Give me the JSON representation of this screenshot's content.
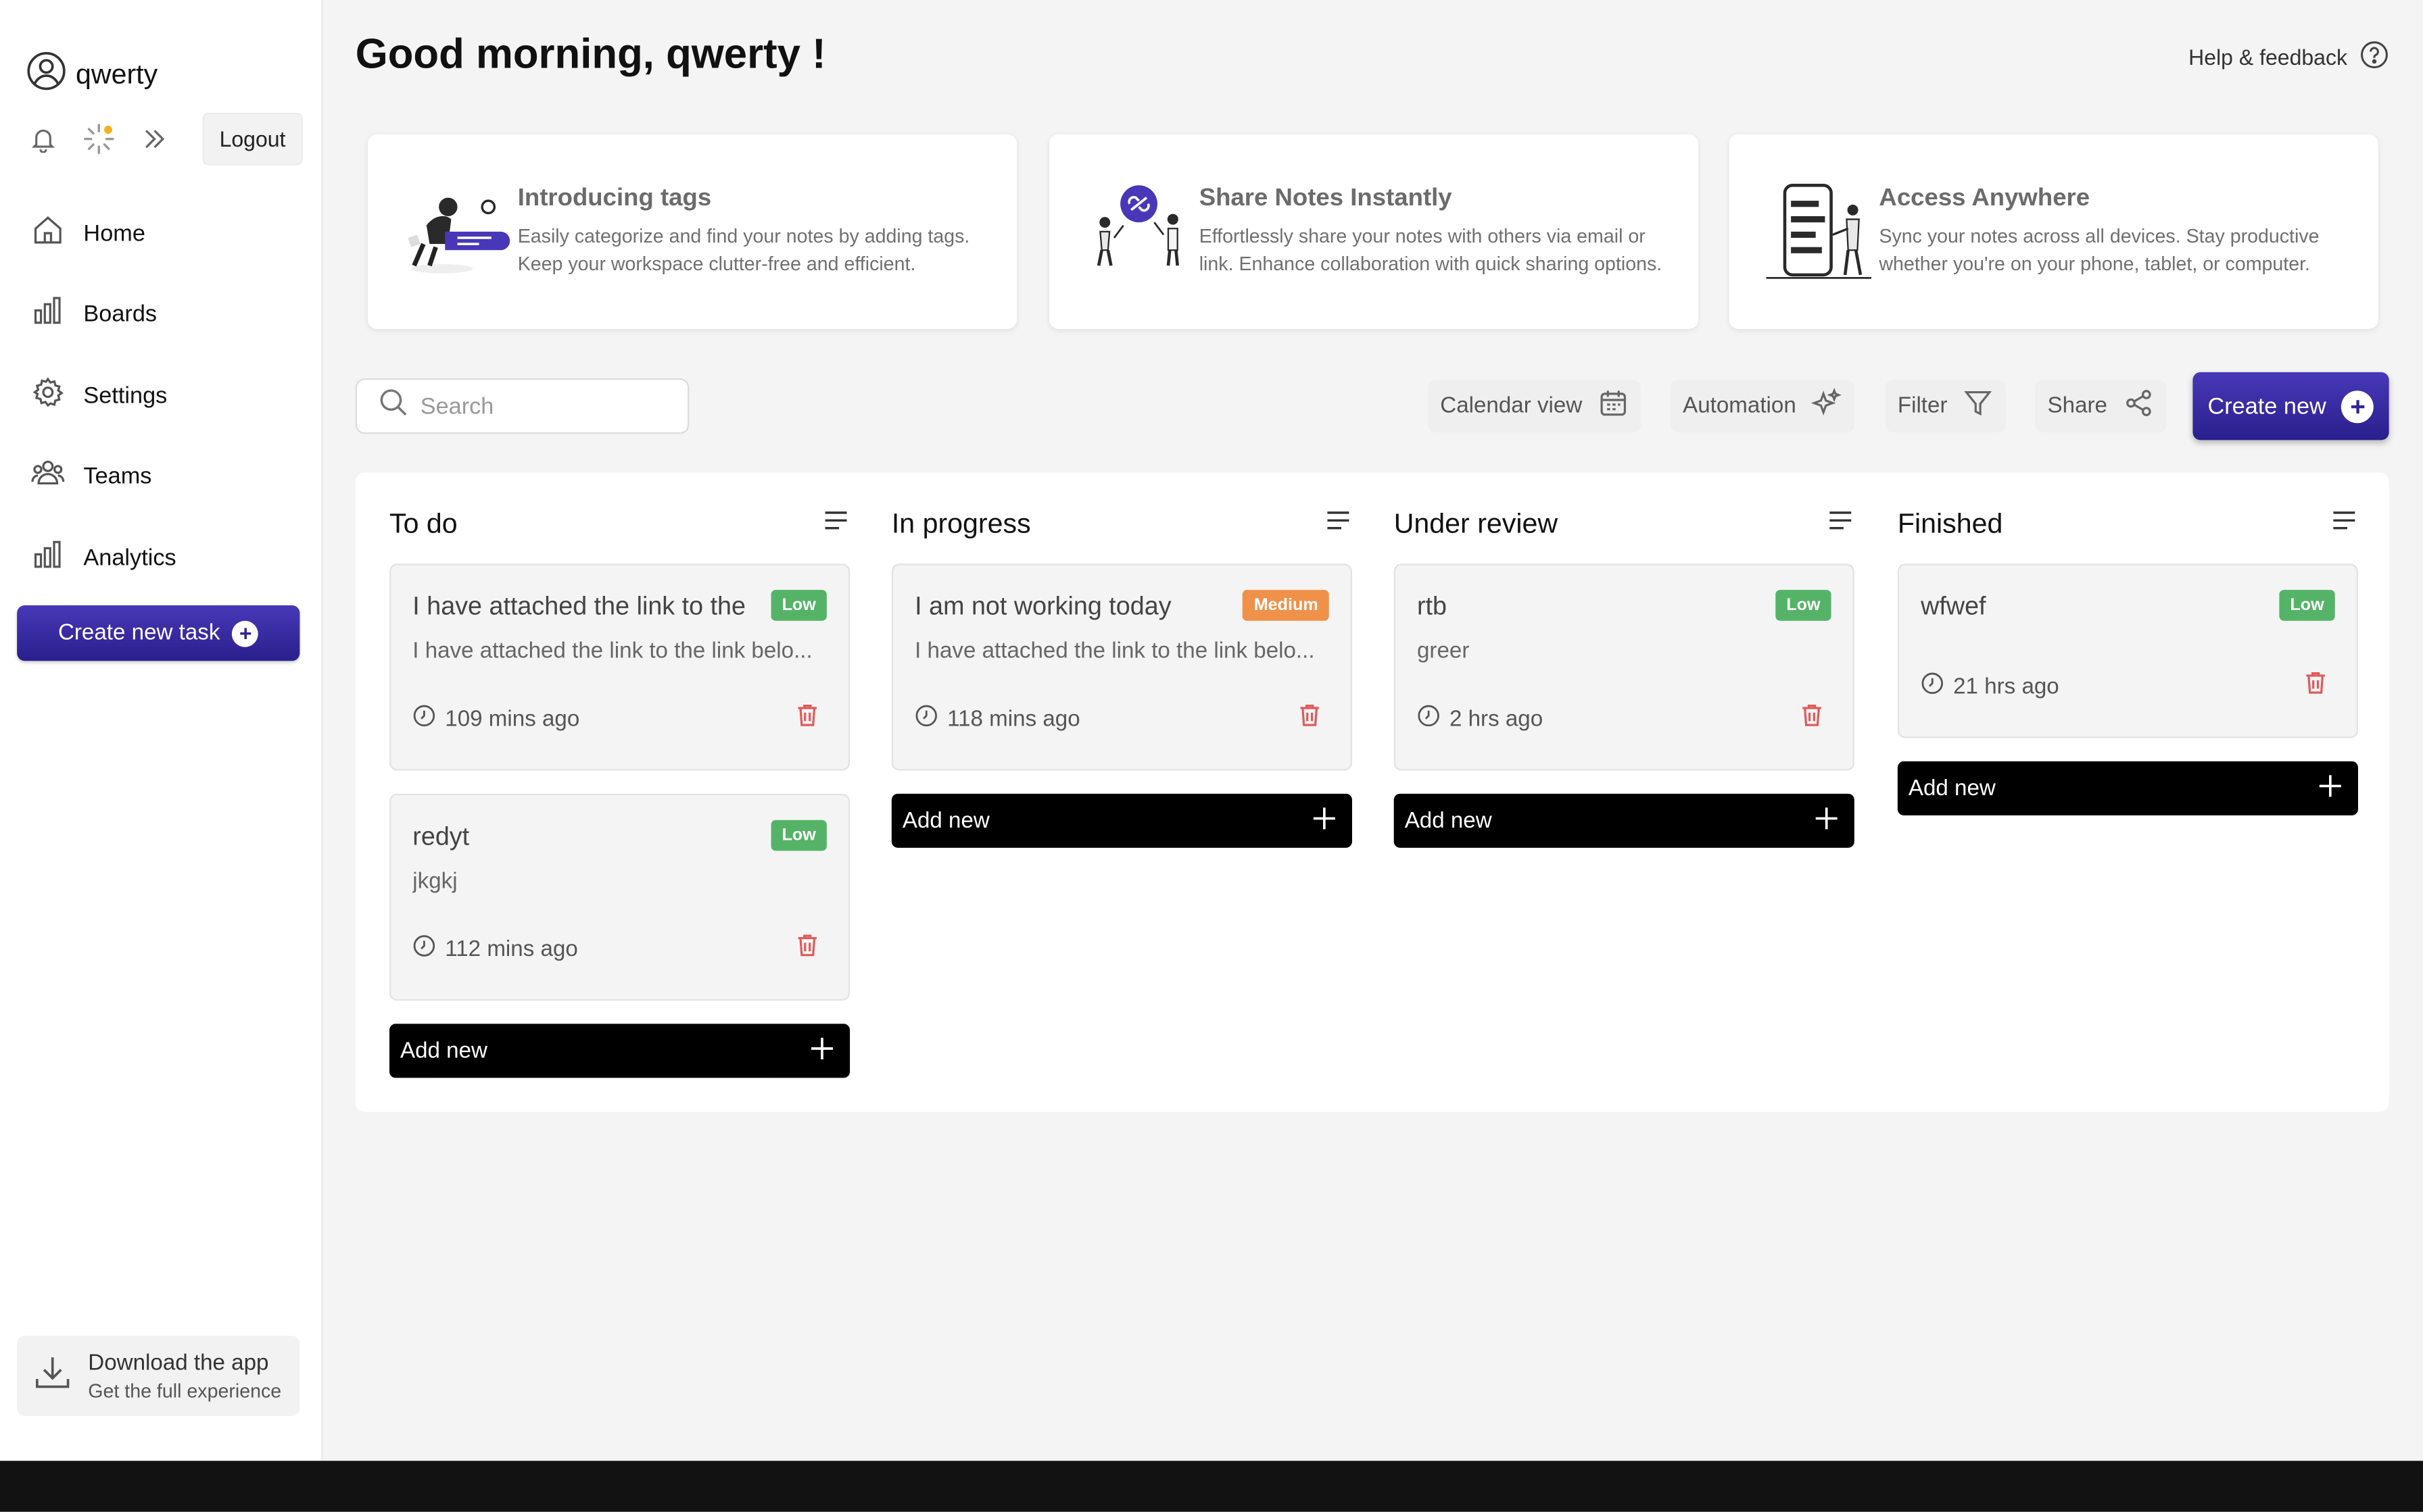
{
  "user": {
    "name": "qwerty"
  },
  "sidebar": {
    "logout_label": "Logout",
    "nav": [
      {
        "label": "Home",
        "icon": "home-icon"
      },
      {
        "label": "Boards",
        "icon": "chart-bar-icon"
      },
      {
        "label": "Settings",
        "icon": "gear-icon"
      },
      {
        "label": "Teams",
        "icon": "users-icon"
      },
      {
        "label": "Analytics",
        "icon": "chart-bar-icon"
      }
    ],
    "create_task_label": "Create new task",
    "download": {
      "title": "Download the app",
      "subtitle": "Get the full experience"
    }
  },
  "header": {
    "greeting": "Good morning, qwerty !",
    "help_label": "Help & feedback"
  },
  "features": [
    {
      "title": "Introducing tags",
      "desc": "Easily categorize and find your notes by adding tags. Keep your workspace clutter-free and efficient."
    },
    {
      "title": "Share Notes Instantly",
      "desc": "Effortlessly share your notes with others via email or link. Enhance collaboration with quick sharing options."
    },
    {
      "title": "Access Anywhere",
      "desc": "Sync your notes across all devices. Stay productive whether you're on your phone, tablet, or computer."
    }
  ],
  "toolbar": {
    "search_placeholder": "Search",
    "calendar_label": "Calendar view",
    "automation_label": "Automation",
    "filter_label": "Filter",
    "share_label": "Share",
    "create_label": "Create new"
  },
  "board": {
    "add_new_label": "Add new",
    "columns": [
      {
        "title": "To do",
        "cards": [
          {
            "title": "I have attached the link to the",
            "desc": "I have attached the link to the link belo...",
            "time": "109 mins ago",
            "priority": "Low"
          },
          {
            "title": "redyt",
            "desc": "jkgkj",
            "time": "112 mins ago",
            "priority": "Low"
          }
        ]
      },
      {
        "title": "In progress",
        "cards": [
          {
            "title": "I am not working today",
            "desc": "I have attached the link to the link belo...",
            "time": "118 mins ago",
            "priority": "Medium"
          }
        ]
      },
      {
        "title": "Under review",
        "cards": [
          {
            "title": "rtb",
            "desc": "greer",
            "time": "2 hrs ago",
            "priority": "Low"
          }
        ]
      },
      {
        "title": "Finished",
        "cards": [
          {
            "title": "wfwef",
            "desc": "",
            "time": "21 hrs ago",
            "priority": "Low"
          }
        ]
      }
    ]
  },
  "colors": {
    "accent": "#2f2493",
    "low": "#55b368",
    "medium": "#f0914a",
    "trash": "#e05a5a"
  }
}
